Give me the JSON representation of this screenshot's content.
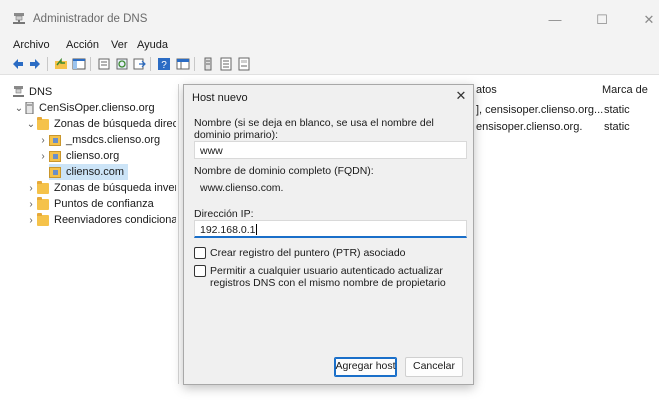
{
  "window": {
    "title": "Administrador de DNS",
    "minimize": "—",
    "maximize": "☐",
    "close": "✕"
  },
  "menu": [
    "Archivo",
    "Acción",
    "Ver",
    "Ayuda"
  ],
  "tree": {
    "root": "DNS",
    "server": "CenSisOper.clienso.org",
    "forward_zones": "Zonas de búsqueda direc",
    "msdcs": "_msdcs.clienso.org",
    "clienso_org": "clienso.org",
    "clienso_com": "clienso.com",
    "reverse_zones": "Zonas de búsqueda inver",
    "trust_points": "Puntos de confianza",
    "forwarders": "Reenviadores condiciona"
  },
  "records": {
    "col_data": "atos",
    "col_timestamp": "Marca de",
    "rows": [
      {
        "data": "], censisoper.clienso.org...",
        "timestamp": "static"
      },
      {
        "data": "ensisoper.clienso.org.",
        "timestamp": "static"
      }
    ]
  },
  "dialog": {
    "title": "Host nuevo",
    "close": "✕",
    "name_label": "Nombre (si se deja en blanco, se usa el nombre del dominio primario):",
    "name_value": "www",
    "fqdn_label": "Nombre de dominio completo (FQDN):",
    "fqdn_value": "www.clienso.com.",
    "ip_label": "Dirección IP:",
    "ip_value": "192.168.0.1",
    "ptr_label": "Crear registro del puntero (PTR) asociado",
    "ptr_checked": false,
    "auth_label": "Permitir a cualquier usuario autenticado actualizar registros DNS con el mismo nombre de propietario",
    "auth_checked": false,
    "add_button": "Agregar host",
    "cancel_button": "Cancelar"
  }
}
